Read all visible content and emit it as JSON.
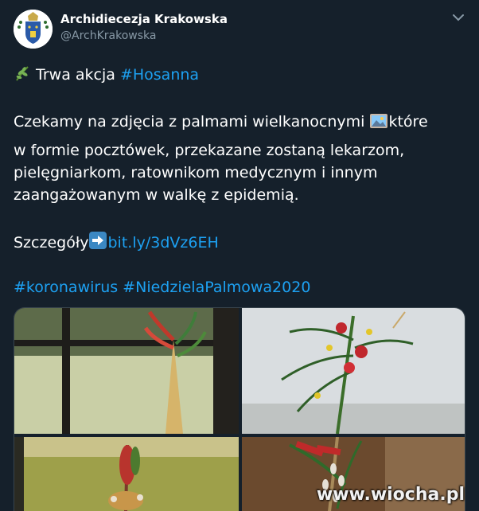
{
  "tweet": {
    "author_name": "Archidiecezja Krakowska",
    "author_handle": "@ArchKrakowska",
    "line1_prefix": "Trwa akcja ",
    "line1_hashtag": "#Hosanna",
    "body_line1_a": "Czekamy na zdjęcia z palmami wielkanocnymi ",
    "body_line1_b": "które",
    "body_line2": "w formie pocztówek, przekazane zostaną lekarzom,",
    "body_line3": "pielęgniarkom, ratownikom medycznym i innym",
    "body_line4": "zaangażowanym w walkę z epidemią.",
    "details_label": "Szczegóły",
    "details_link": "bit.ly/3dVz6EH",
    "hashtags": "#koronawirus #NiedzielaPalmowa2020"
  },
  "media": {
    "photos": [
      "palm-on-windowsill",
      "palm-on-white-wall",
      "palm-in-garden",
      "palm-with-catkins"
    ]
  },
  "watermark": "www.wiocha.pl",
  "icons": [
    "coat-of-arms-icon",
    "chevron-down-icon",
    "herb-emoji-icon",
    "framed-picture-emoji-icon",
    "right-arrow-emoji-icon"
  ],
  "colors": {
    "background": "#15202b",
    "link": "#1da1f2",
    "secondary_text": "#8899a6"
  }
}
